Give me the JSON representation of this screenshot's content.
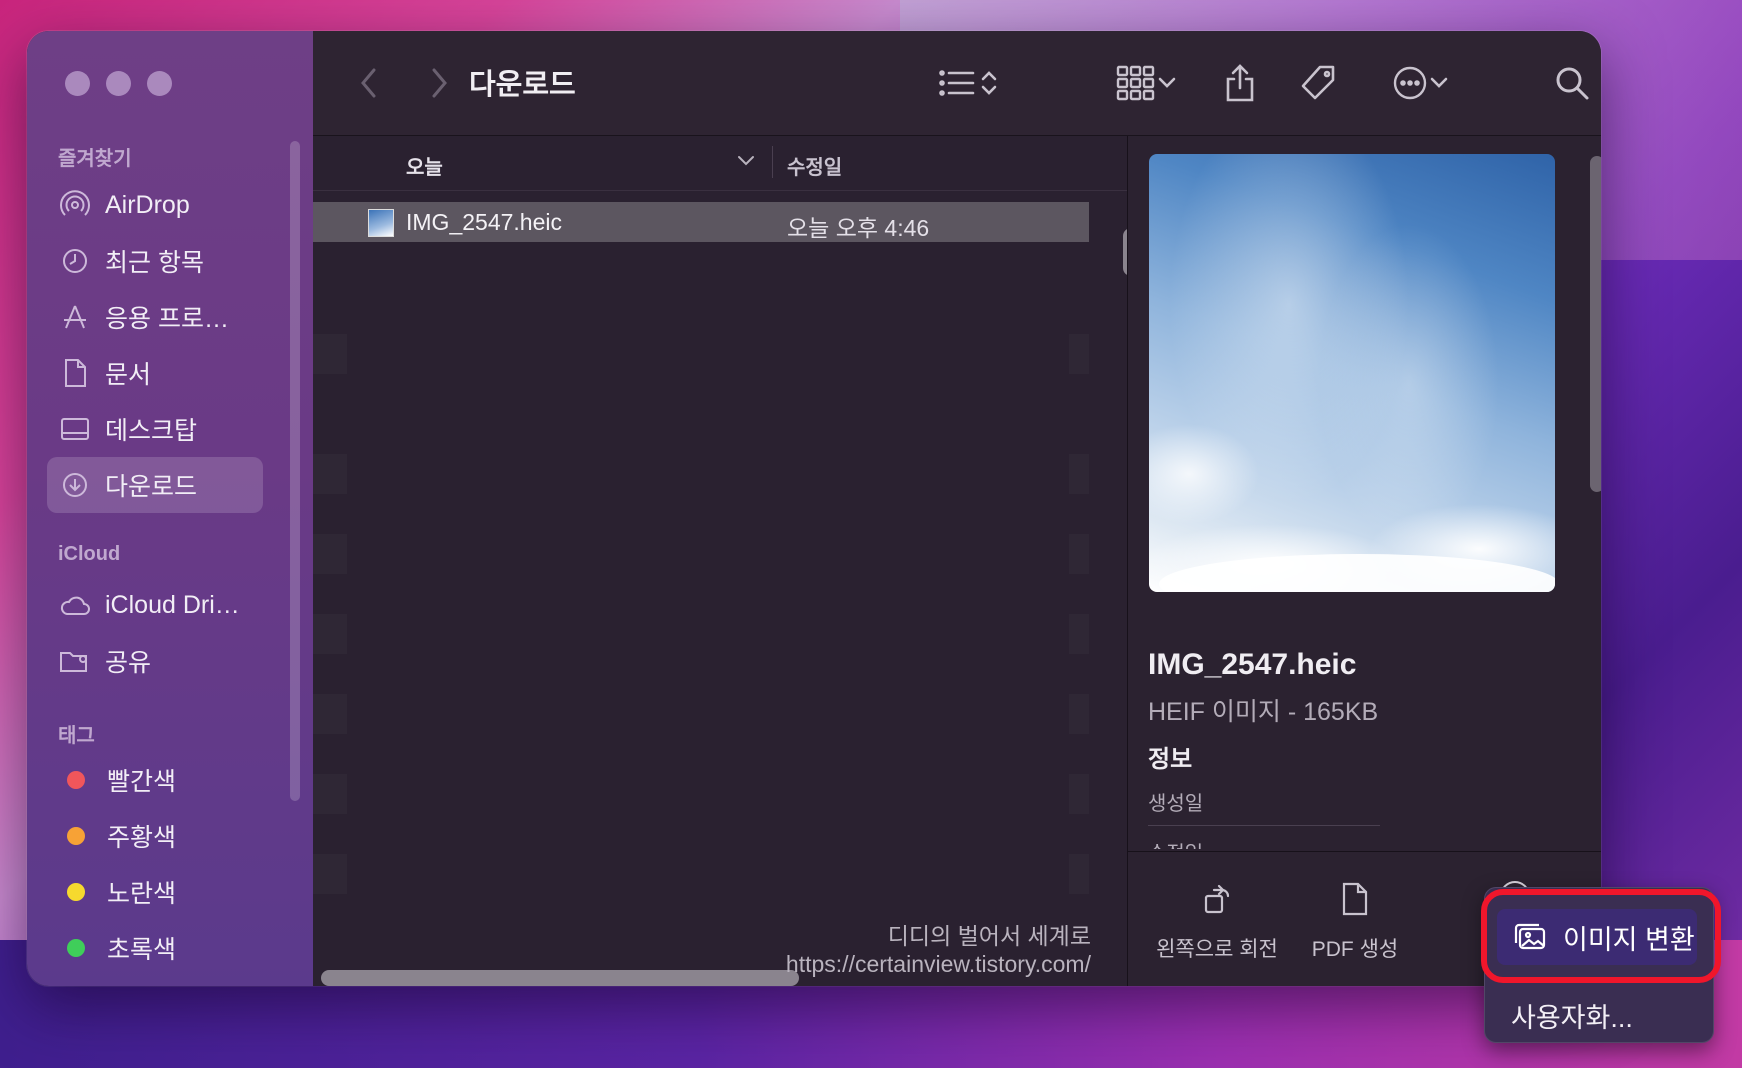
{
  "window": {
    "title": "다운로드"
  },
  "sidebar": {
    "favorites_title": "즐겨찾기",
    "favorites": [
      {
        "label": "AirDrop",
        "icon": "airdrop-icon"
      },
      {
        "label": "최근 항목",
        "icon": "clock-icon"
      },
      {
        "label": "응용 프로…",
        "icon": "applications-icon"
      },
      {
        "label": "문서",
        "icon": "document-icon"
      },
      {
        "label": "데스크탑",
        "icon": "desktop-icon"
      },
      {
        "label": "다운로드",
        "icon": "download-icon",
        "selected": true
      }
    ],
    "icloud_title": "iCloud",
    "icloud": [
      {
        "label": "iCloud Dri…",
        "icon": "cloud-icon"
      },
      {
        "label": "공유",
        "icon": "shared-folder-icon"
      }
    ],
    "tags_title": "태그",
    "tags": [
      {
        "label": "빨간색",
        "color": "#f0565b"
      },
      {
        "label": "주황색",
        "color": "#f7a236"
      },
      {
        "label": "노란색",
        "color": "#f6d92e"
      },
      {
        "label": "초록색",
        "color": "#3fce5a"
      }
    ]
  },
  "list": {
    "col_name": "오늘",
    "col_modified": "수정일",
    "rows": [
      {
        "name": "IMG_2547.heic",
        "modified": "오늘 오후 4:46",
        "selected": true
      }
    ]
  },
  "watermark": {
    "line1": "디디의 벌어서 세계로",
    "line2": "https://certainview.tistory.com/"
  },
  "preview": {
    "file_name": "IMG_2547.heic",
    "file_type": "HEIF 이미지 - 165KB",
    "info_title": "정보",
    "created_label": "생성일",
    "modified_label": "수정일"
  },
  "actions": {
    "rotate_left": "왼쪽으로 회전",
    "create_pdf": "PDF 생성"
  },
  "popup_menu": {
    "convert_image": "이미지 변환",
    "customize": "사용자화..."
  }
}
